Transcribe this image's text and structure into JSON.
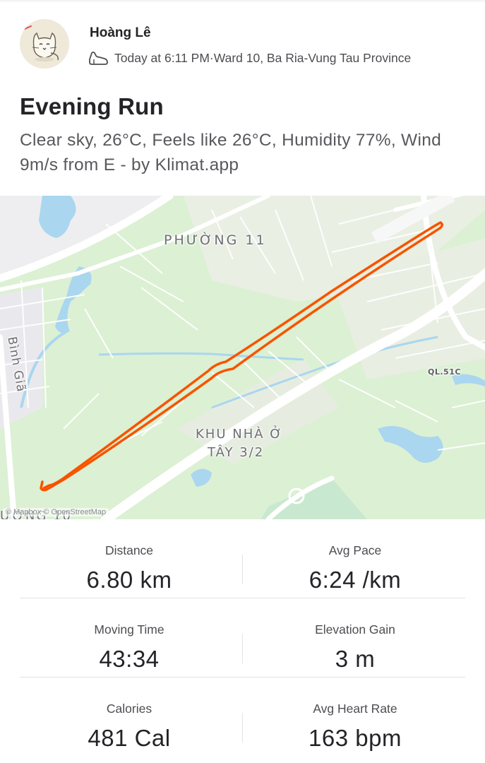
{
  "activity": {
    "author": "Hoàng Lê",
    "timestamp": "Today at 6:11 PM",
    "separator": " · ",
    "location": "Ward 10, Ba Ria-Vung Tau Province",
    "title": "Evening Run",
    "description": "Clear sky, 26°C, Feels like 26°C, Humidity 77%, Wind 9m/s from E - by Klimat.app",
    "icons": {
      "avatar": "cat-avatar-icon",
      "activity_type": "running-shoe-icon"
    }
  },
  "map": {
    "labels": {
      "phuong11": "PHƯỜNG 11",
      "binhgia": "Bình Giã",
      "ql51c": "QL.51C",
      "khu_line1": "KHU NHÀ Ở",
      "khu_line2": "TÂY 3/2",
      "phuong10": "ƯỜNG 10"
    },
    "attribution": "© Mapbox © OpenStreetMap",
    "colors": {
      "route": "#ff5a00",
      "water": "#aad6ef",
      "park": "#dcf0d4",
      "road": "#ffffff"
    }
  },
  "stats": [
    {
      "label": "Distance",
      "value": "6.80 km"
    },
    {
      "label": "Avg Pace",
      "value": "6:24 /km"
    },
    {
      "label": "Moving Time",
      "value": "43:34"
    },
    {
      "label": "Elevation Gain",
      "value": "3 m"
    },
    {
      "label": "Calories",
      "value": "481 Cal"
    },
    {
      "label": "Avg Heart Rate",
      "value": "163 bpm"
    }
  ]
}
